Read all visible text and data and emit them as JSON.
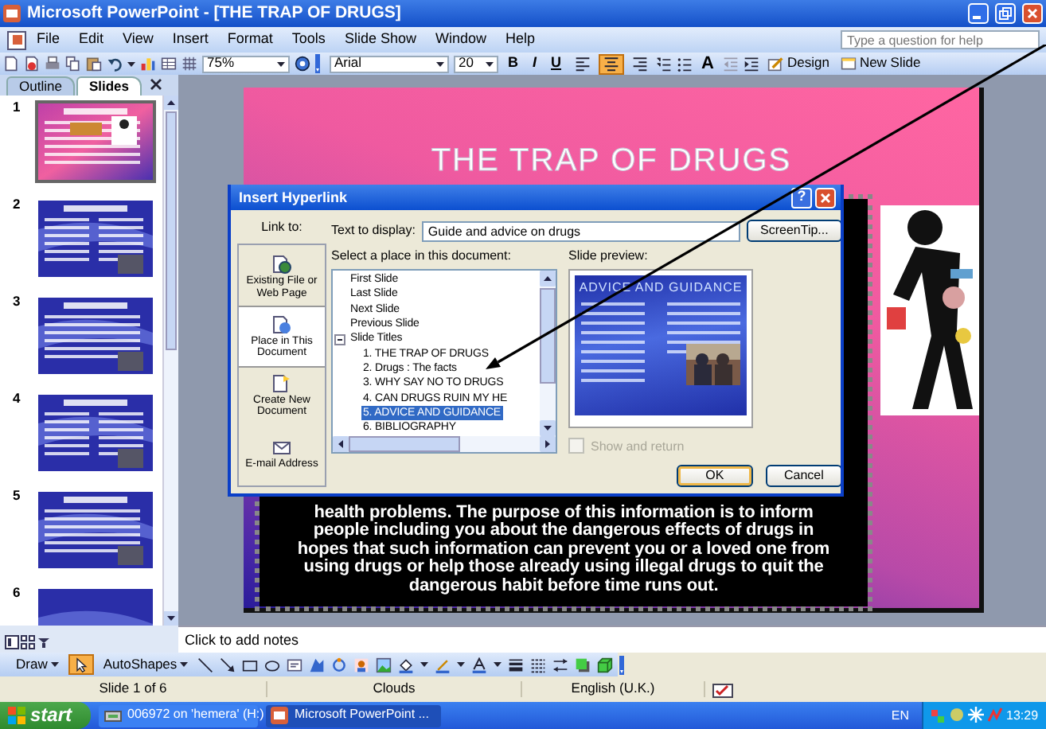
{
  "window": {
    "title": "Microsoft PowerPoint - [THE TRAP OF DRUGS]"
  },
  "menu": [
    "File",
    "Edit",
    "View",
    "Insert",
    "Format",
    "Tools",
    "Slide Show",
    "Window",
    "Help"
  ],
  "help_box": {
    "placeholder": "Type a question for help"
  },
  "toolbar": {
    "zoom": "75%",
    "font": "Arial",
    "font_size": "20",
    "format": [
      {
        "label": "B"
      },
      {
        "label": "I"
      },
      {
        "label": "U"
      }
    ],
    "align": [
      {
        "selected": false
      },
      {
        "selected": true
      },
      {
        "selected": false
      }
    ],
    "grow_font": "A",
    "design": "Design",
    "new_slide": "New Slide"
  },
  "pane_tabs": [
    {
      "label": "Outline",
      "selected": false
    },
    {
      "label": "Slides",
      "selected": true
    }
  ],
  "slides": [
    {
      "number": "1",
      "selected": true,
      "kind": "pink"
    },
    {
      "number": "2",
      "selected": false,
      "kind": "blue"
    },
    {
      "number": "3",
      "selected": false,
      "kind": "blue"
    },
    {
      "number": "4",
      "selected": false,
      "kind": "blue"
    },
    {
      "number": "5",
      "selected": false,
      "kind": "blue"
    },
    {
      "number": "6",
      "selected": false,
      "kind": "blue"
    }
  ],
  "slide": {
    "title": "THE TRAP OF DRUGS",
    "body": [
      "health problems. The purpose of this information is to inform",
      "people including you about the dangerous effects of drugs in",
      "hopes that such information can prevent you or a loved one from",
      "using drugs or help those already using illegal drugs to quit the",
      "dangerous habit before time runs out."
    ]
  },
  "dialog": {
    "title": "Insert Hyperlink",
    "help": "?",
    "link_to_label": "Link to:",
    "link_to": [
      {
        "label": "Existing File or Web Page",
        "selected": false
      },
      {
        "label": "Place in This Document",
        "selected": true
      },
      {
        "label": "Create New Document",
        "selected": false
      },
      {
        "label": "E-mail Address",
        "selected": false
      }
    ],
    "text_label": "Text to display:",
    "text_value": "Guide and advice on drugs",
    "screentip": "ScreenTip...",
    "place_label": "Select a place in this document:",
    "tree": [
      {
        "label": "First Slide",
        "selected": false
      },
      {
        "label": "Last Slide",
        "selected": false
      },
      {
        "label": "Next Slide",
        "selected": false
      },
      {
        "label": "Previous Slide",
        "selected": false
      },
      {
        "label": "Slide Titles",
        "selected": false,
        "expanded": true,
        "children": [
          {
            "label": "1. THE TRAP OF DRUGS",
            "selected": false
          },
          {
            "label": "2. Drugs : The facts",
            "selected": false
          },
          {
            "label": "3. WHY SAY NO TO DRUGS",
            "selected": false
          },
          {
            "label": "4. CAN DRUGS RUIN MY HE",
            "selected": false
          },
          {
            "label": "5. ADVICE AND GUIDANCE",
            "selected": true
          },
          {
            "label": "6. BIBLIOGRAPHY",
            "selected": false
          }
        ]
      }
    ],
    "preview_label": "Slide preview:",
    "preview_title": "ADVICE AND GUIDANCE",
    "show_return": {
      "label": "Show and return",
      "checked": false,
      "disabled": true
    },
    "buttons": [
      {
        "label": "OK",
        "default": true
      },
      {
        "label": "Cancel",
        "default": false
      }
    ]
  },
  "notes": {
    "placeholder": "Click to add notes"
  },
  "drawing_toolbar": {
    "draw": "Draw",
    "pointer": {
      "selected": true
    },
    "autoshapes": "AutoShapes"
  },
  "status_bar": [
    "Slide 1 of 6",
    "Clouds",
    "English (U.K.)"
  ],
  "taskbar": {
    "start": "start",
    "tasks": [
      {
        "label": "006972 on 'hemera' (H:)",
        "selected": false
      },
      {
        "label": "Microsoft PowerPoint ...",
        "selected": true
      }
    ],
    "language": "EN",
    "clock": "13:29"
  }
}
